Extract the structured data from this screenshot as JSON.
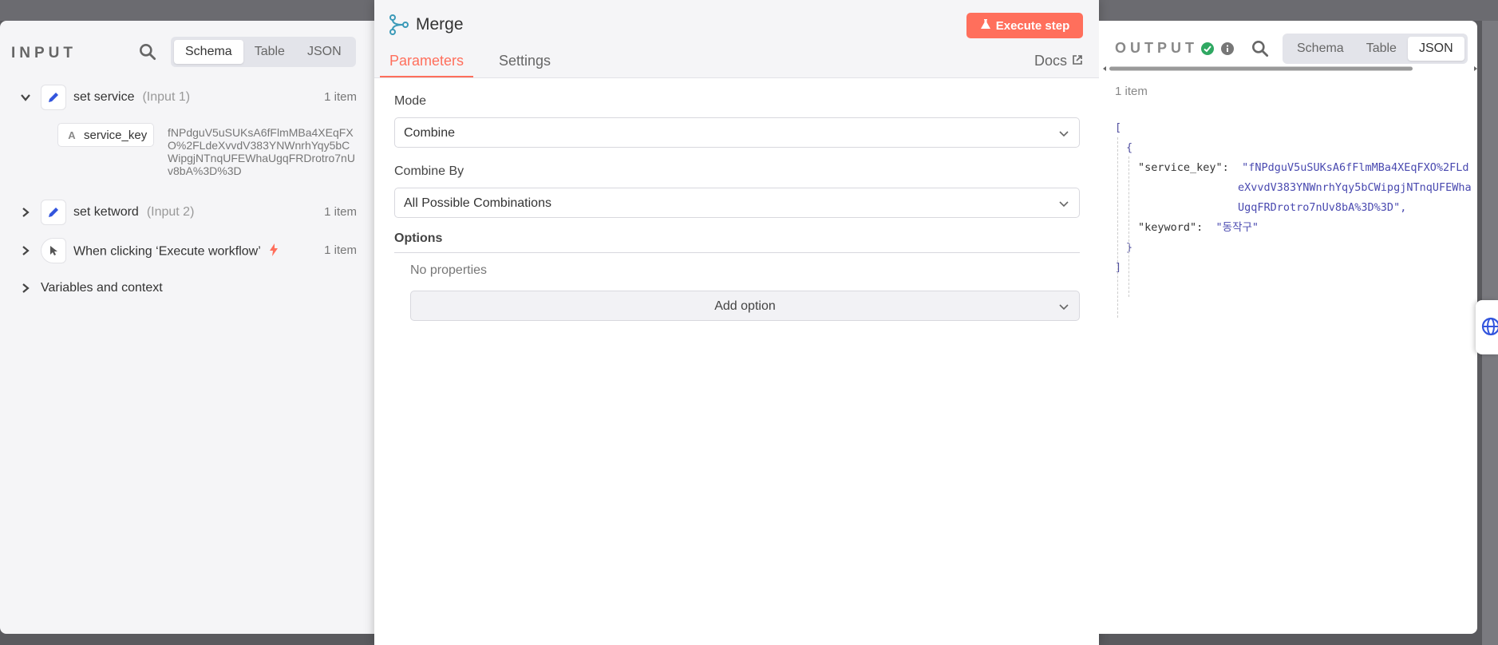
{
  "input": {
    "title": "INPUT",
    "view_tabs": [
      "Schema",
      "Table",
      "JSON"
    ],
    "active_view": "Schema",
    "nodes": [
      {
        "name": "set service",
        "tag": "(Input 1)",
        "count": "1 item",
        "expanded": true,
        "icon": "pencil-icon"
      },
      {
        "name": "set ketword",
        "tag": "(Input 2)",
        "count": "1 item",
        "expanded": false,
        "icon": "pencil-icon"
      },
      {
        "name": "When clicking ‘Execute workflow’",
        "tag": "",
        "count": "1 item",
        "expanded": false,
        "icon": "cursor-icon"
      }
    ],
    "field": {
      "type": "A",
      "key": "service_key",
      "value": "fNPdguV5uSUKsA6fFlmMBa4XEqFXO%2FLdeXvvdV383YNWnrhYqy5bCWipgjNTnqUFEWhaUgqFRDrotro7nUv8bA%3D%3D"
    },
    "variables_label": "Variables and context"
  },
  "main": {
    "title": "Merge",
    "execute_label": "Execute step",
    "tabs": [
      "Parameters",
      "Settings"
    ],
    "active_tab": "Parameters",
    "docs_label": "Docs",
    "mode_label": "Mode",
    "mode_value": "Combine",
    "combine_by_label": "Combine By",
    "combine_by_value": "All Possible Combinations",
    "options_label": "Options",
    "no_props": "No properties",
    "add_option_label": "Add option"
  },
  "output": {
    "title": "OUTPUT",
    "view_tabs": [
      "Schema",
      "Table",
      "JSON"
    ],
    "active_view": "JSON",
    "count": "1 item",
    "json": {
      "open_bracket": "[",
      "open_brace": "{",
      "key1": "\"service_key\":",
      "val1_line1": "\"fNPdguV5uSUKsA6fFlmMBa4XEqFXO%2FLd",
      "val1_line2": "eXvvdV383YNWnrhYqy5bCWipgjNTnqUFEWha",
      "val1_line3": "UgqFRDrotro7nUv8bA%3D%3D\",",
      "key2": "\"keyword\":",
      "val2": "\"동작구\"",
      "close_brace": "}",
      "close_bracket": "]"
    }
  },
  "colors": {
    "accent": "#ff6f5c",
    "success": "#2fa862"
  }
}
